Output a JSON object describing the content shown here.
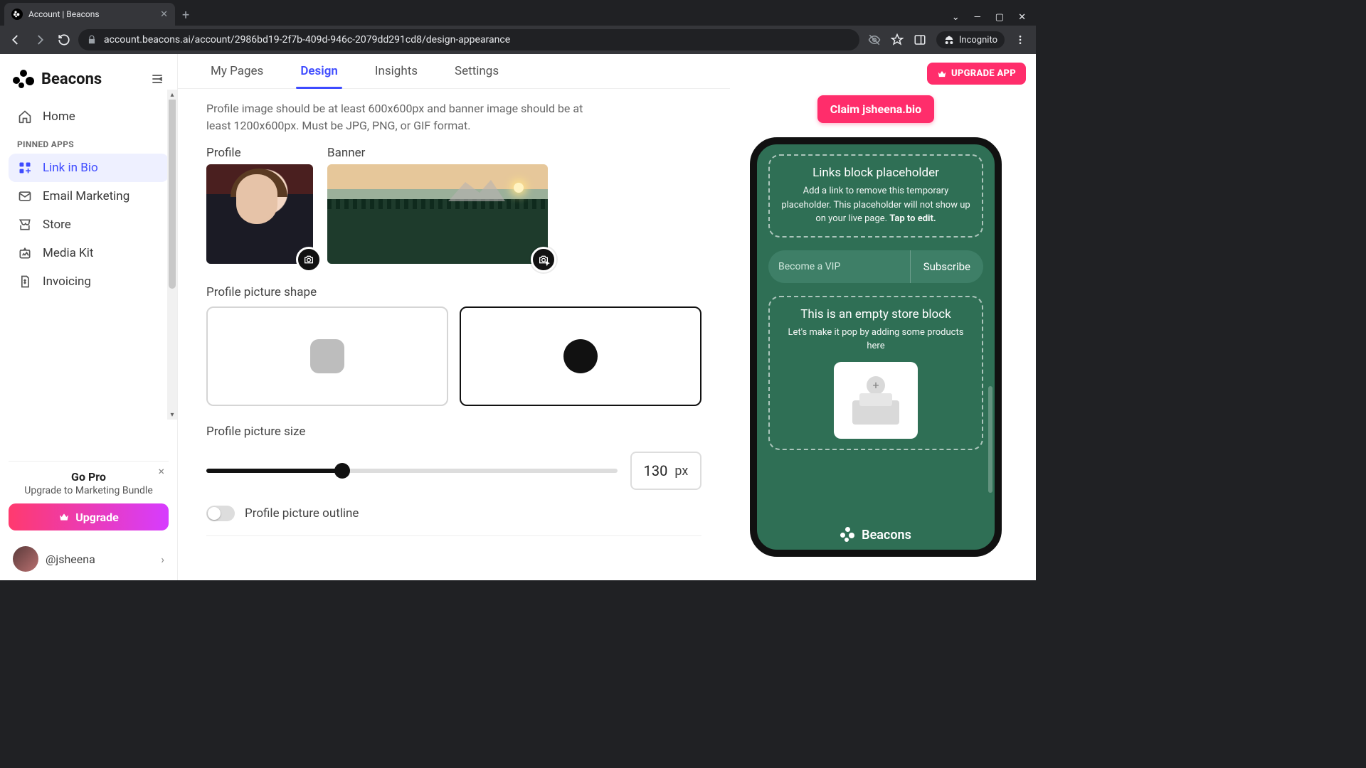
{
  "browser": {
    "tab_title": "Account | Beacons",
    "url": "account.beacons.ai/account/2986bd19-2f7b-409d-946c-2079dd291cd8/design-appearance",
    "incognito_label": "Incognito"
  },
  "brand": "Beacons",
  "top_tabs": {
    "my_pages": "My Pages",
    "design": "Design",
    "insights": "Insights",
    "settings": "Settings"
  },
  "upgrade_button": "UPGRADE APP",
  "claim_button": "Claim jsheena.bio",
  "sidebar": {
    "home": "Home",
    "pinned_label": "PINNED APPS",
    "items": [
      {
        "label": "Link in Bio"
      },
      {
        "label": "Email Marketing"
      },
      {
        "label": "Store"
      },
      {
        "label": "Media Kit"
      },
      {
        "label": "Invoicing"
      }
    ],
    "promo": {
      "title": "Go Pro",
      "subtitle": "Upgrade to Marketing Bundle",
      "cta": "Upgrade"
    },
    "user_handle": "@jsheena"
  },
  "editor": {
    "hint": "Profile image should be at least 600x600px and banner image should be at least 1200x600px. Must be JPG, PNG, or GIF format.",
    "profile_label": "Profile",
    "banner_label": "Banner",
    "shape_label": "Profile picture shape",
    "size_label": "Profile picture size",
    "size_value": "130",
    "size_unit": "px",
    "outline_label": "Profile picture outline"
  },
  "preview": {
    "links_title": "Links block placeholder",
    "links_body_1": "Add a link to remove this temporary placeholder. This placeholder will not show up on your live page. ",
    "links_body_2": "Tap to edit.",
    "vip_placeholder": "Become a VIP",
    "vip_cta": "Subscribe",
    "store_title": "This is an empty store block",
    "store_body": "Let's make it pop by adding some products here",
    "footer_brand": "Beacons"
  }
}
